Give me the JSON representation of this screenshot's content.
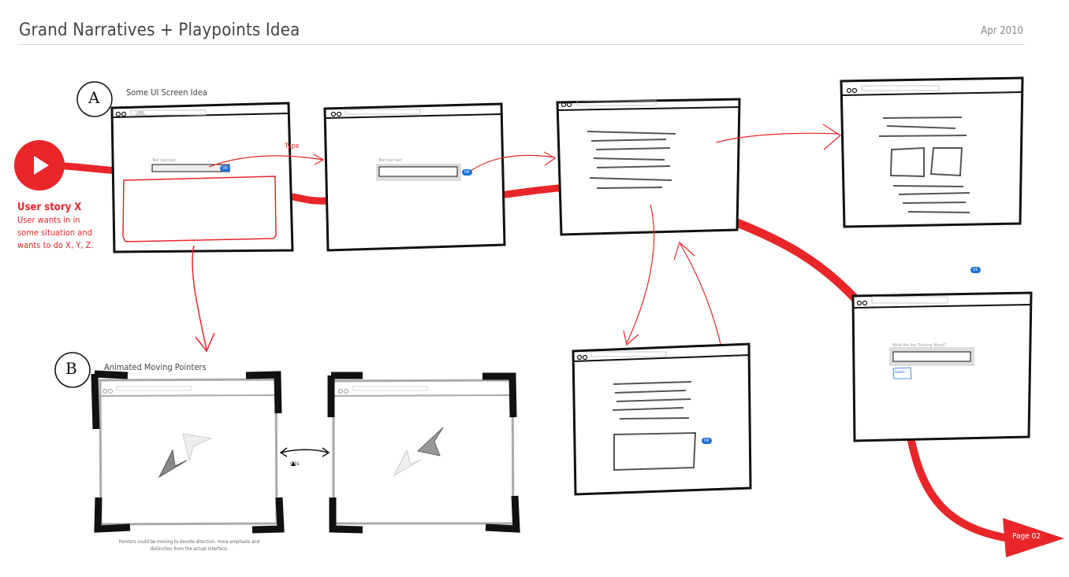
{
  "header": {
    "title": "Grand Narratives + Playpoints Idea",
    "date": "Apr 2010"
  },
  "story": {
    "title": "User story X",
    "lines": [
      "User wants in in",
      "some situation and",
      "wants to do X, Y, Z."
    ]
  },
  "sections": {
    "a_marker": "A",
    "a_label": "Some UI Screen Idea",
    "b_marker": "B",
    "b_label": "Animated Moving Pointers"
  },
  "screen_a": {
    "url": "URL",
    "field_label": "Text text text",
    "ok": "OK"
  },
  "screen_2": {
    "field_label": "Text text text",
    "ok": "OK"
  },
  "arrow_label": "Type",
  "thinking_screen": {
    "field_label": "What Are You Thinking About?",
    "button": "Submit"
  },
  "floating_ok": "OK",
  "modal_ok": "OK",
  "timer": "0.5s",
  "note": "Pointers could be moving to denote direction, more emphasis and distinction from the actual interface.",
  "page_link": "Page 02",
  "colors": {
    "accent": "#e8262a",
    "ink": "#111111",
    "badge": "#1a6fd8"
  }
}
